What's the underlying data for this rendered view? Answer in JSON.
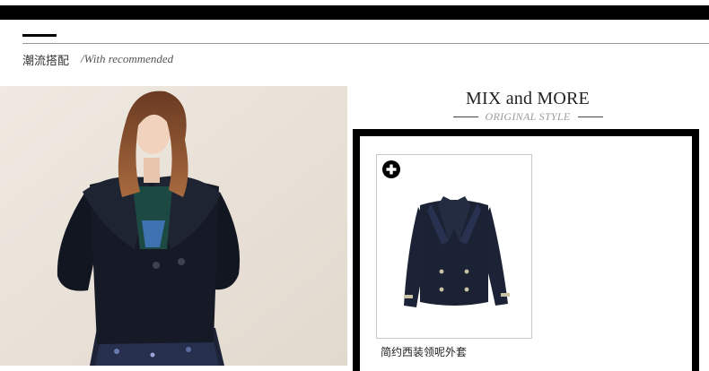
{
  "section": {
    "title": "潮流搭配",
    "subtitle": "/With recommended"
  },
  "mix": {
    "title": "MIX and MORE",
    "subtitle": "ORIGINAL STYLE"
  },
  "product": {
    "name": "简约西装领呢外套",
    "add_icon": "plus-circle-icon"
  },
  "colors": {
    "accent": "#000000",
    "rule": "#9a9a9a",
    "subtitle_gray": "#9a9a9a",
    "coat_navy": "#1b2233"
  }
}
